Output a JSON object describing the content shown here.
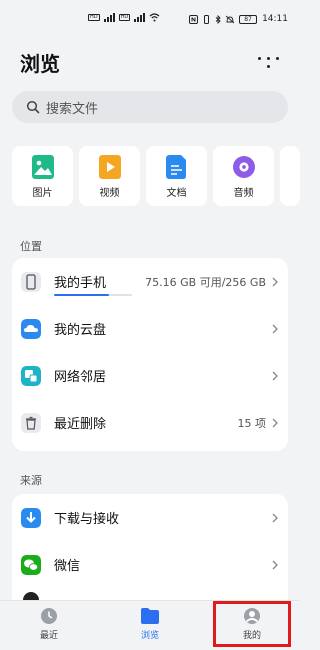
{
  "status_bar": {
    "time": "14:11",
    "battery": "87"
  },
  "header": {
    "title": "浏览"
  },
  "search": {
    "placeholder": "搜索文件"
  },
  "categories": [
    {
      "label": "图片",
      "icon": "image-icon"
    },
    {
      "label": "视频",
      "icon": "video-icon"
    },
    {
      "label": "文档",
      "icon": "document-icon"
    },
    {
      "label": "音频",
      "icon": "audio-icon"
    }
  ],
  "locations": {
    "title": "位置",
    "items": [
      {
        "label": "我的手机",
        "detail": "75.16 GB 可用/256 GB",
        "icon": "phone-icon",
        "storage_used_fraction": 0.71
      },
      {
        "label": "我的云盘",
        "icon": "cloud-drive-icon"
      },
      {
        "label": "网络邻居",
        "icon": "network-icon"
      },
      {
        "label": "最近删除",
        "detail": "15 项",
        "icon": "trash-icon"
      }
    ]
  },
  "sources": {
    "title": "来源",
    "items": [
      {
        "label": "下载与接收",
        "icon": "download-icon"
      },
      {
        "label": "微信",
        "icon": "wechat-icon"
      }
    ]
  },
  "bottom_nav": {
    "items": [
      {
        "label": "最近",
        "icon": "clock-icon",
        "active": false
      },
      {
        "label": "浏览",
        "icon": "folder-icon",
        "active": true
      },
      {
        "label": "我的",
        "icon": "profile-icon",
        "active": false
      }
    ]
  },
  "colors": {
    "accent": "#2b6ff0",
    "highlight": "#e01b1b",
    "background": "#f1f3f5"
  }
}
